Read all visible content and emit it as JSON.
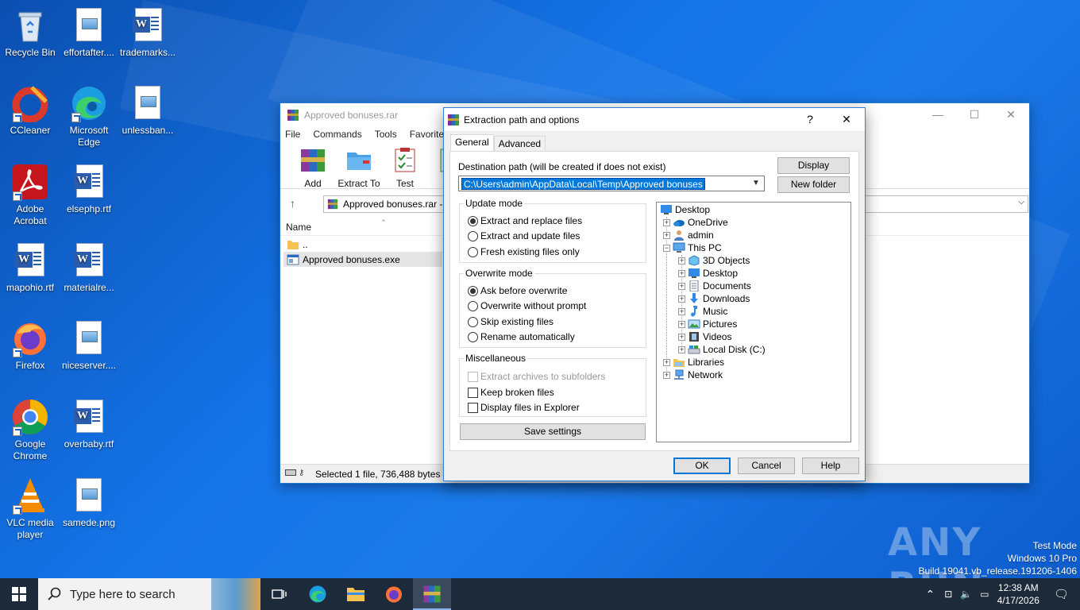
{
  "desktop": {
    "icons": [
      {
        "label": "Recycle Bin"
      },
      {
        "label": "effortafter...."
      },
      {
        "label": "trademarks..."
      },
      {
        "label": "CCleaner"
      },
      {
        "label": "Microsoft Edge"
      },
      {
        "label": "unlessban..."
      },
      {
        "label": "Adobe Acrobat"
      },
      {
        "label": "elsephp.rtf"
      },
      {
        "label": "mapohio.rtf"
      },
      {
        "label": "materialre..."
      },
      {
        "label": "Firefox"
      },
      {
        "label": "niceserver...."
      },
      {
        "label": "Google Chrome"
      },
      {
        "label": "overbaby.rtf"
      },
      {
        "label": "VLC media player"
      },
      {
        "label": "samede.png"
      }
    ]
  },
  "winrar": {
    "title": "Approved bonuses.rar",
    "menu": [
      "File",
      "Commands",
      "Tools",
      "Favorites"
    ],
    "toolbar": [
      "Add",
      "Extract To",
      "Test",
      "Vi"
    ],
    "address": "Approved bonuses.rar -",
    "column_name": "Name",
    "files": [
      {
        "name": ".."
      },
      {
        "name": "Approved bonuses.exe"
      }
    ],
    "status": "Selected 1 file, 736,488 bytes"
  },
  "dialog": {
    "title": "Extraction path and options",
    "help_glyph": "?",
    "close_glyph": "✕",
    "tabs": [
      "General",
      "Advanced"
    ],
    "dest_label": "Destination path (will be created if does not exist)",
    "dest_value": "C:\\Users\\admin\\AppData\\Local\\Temp\\Approved bonuses",
    "display_button": "Display",
    "new_folder_button": "New folder",
    "update_mode": {
      "title": "Update mode",
      "options": [
        "Extract and replace files",
        "Extract and update files",
        "Fresh existing files only"
      ],
      "selected": 0
    },
    "overwrite_mode": {
      "title": "Overwrite mode",
      "options": [
        "Ask before overwrite",
        "Overwrite without prompt",
        "Skip existing files",
        "Rename automatically"
      ],
      "selected": 0
    },
    "misc": {
      "title": "Miscellaneous",
      "options": [
        "Extract archives to subfolders",
        "Keep broken files",
        "Display files in Explorer"
      ]
    },
    "save_settings": "Save settings",
    "tree": [
      "Desktop",
      "OneDrive",
      "admin",
      "This PC",
      "3D Objects",
      "Desktop",
      "Documents",
      "Downloads",
      "Music",
      "Pictures",
      "Videos",
      "Local Disk (C:)",
      "Libraries",
      "Network"
    ],
    "ok": "OK",
    "cancel": "Cancel",
    "help": "Help"
  },
  "taskbar": {
    "search_placeholder": "Type here to search",
    "time": "12:38 AM",
    "date": "4/17/2026"
  },
  "watermark": {
    "line1": "Test Mode",
    "line2": "Windows 10 Pro",
    "line3": "Build 19041.vb_release.191206-1406",
    "brand": "ANY RUN"
  },
  "colors": {
    "accent": "#0078d7",
    "desktop_blue": "#1473e6",
    "taskbar": "#1c2a3a"
  }
}
